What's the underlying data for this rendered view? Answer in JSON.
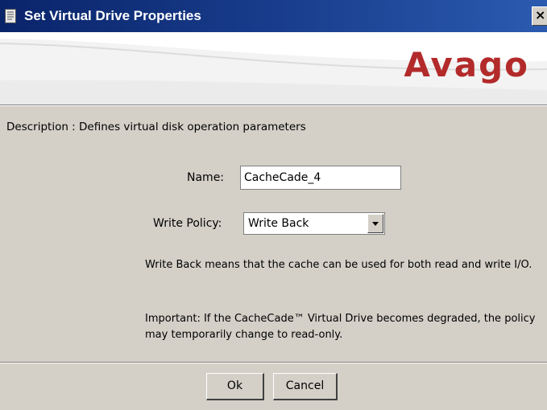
{
  "window": {
    "title": "Set Virtual Drive Properties",
    "icon": "document-icon",
    "close_label": "×"
  },
  "banner": {
    "brand": "Avago",
    "brand_color": "#b32a2a"
  },
  "form": {
    "description": "Description : Defines virtual disk operation parameters",
    "name_label": "Name:",
    "name_value": "CacheCade_4",
    "policy_label": "Write Policy:",
    "policy_value": "Write Back",
    "policy_help": "Write Back means that the cache can be used for both read and write I/O.",
    "important_note": "Important: If the CacheCade™ Virtual Drive becomes degraded, the policy may temporarily change to read-only."
  },
  "buttons": {
    "ok": "Ok",
    "cancel": "Cancel"
  }
}
